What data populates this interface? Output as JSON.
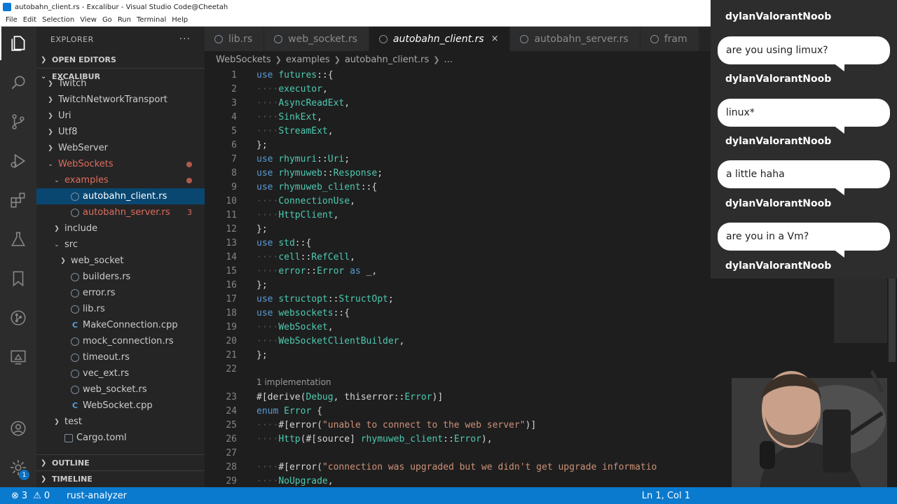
{
  "window": {
    "title": "autobahn_client.rs - Excalibur - Visual Studio Code@Cheetah"
  },
  "menu": [
    "File",
    "Edit",
    "Selection",
    "View",
    "Go",
    "Run",
    "Terminal",
    "Help"
  ],
  "sidebar": {
    "title": "EXPLORER",
    "more": "···",
    "open_editors": "OPEN EDITORS",
    "workspace": "EXCALIBUR",
    "items": [
      {
        "label": "Twitch",
        "type": "folder",
        "open": false
      },
      {
        "label": "TwitchNetworkTransport",
        "type": "folder",
        "open": false
      },
      {
        "label": "Uri",
        "type": "folder",
        "open": false
      },
      {
        "label": "Utf8",
        "type": "folder",
        "open": false
      },
      {
        "label": "WebServer",
        "type": "folder",
        "open": false
      },
      {
        "label": "WebSockets",
        "type": "folder",
        "open": true
      },
      {
        "label": "examples",
        "type": "folder",
        "open": true
      },
      {
        "label": "autobahn_client.rs",
        "type": "rs"
      },
      {
        "label": "autobahn_server.rs",
        "type": "rs",
        "problems": "3"
      },
      {
        "label": "include",
        "type": "folder",
        "open": false
      },
      {
        "label": "src",
        "type": "folder",
        "open": true
      },
      {
        "label": "web_socket",
        "type": "folder",
        "open": false
      },
      {
        "label": "builders.rs",
        "type": "rs"
      },
      {
        "label": "error.rs",
        "type": "rs"
      },
      {
        "label": "lib.rs",
        "type": "rs"
      },
      {
        "label": "MakeConnection.cpp",
        "type": "cpp"
      },
      {
        "label": "mock_connection.rs",
        "type": "rs"
      },
      {
        "label": "timeout.rs",
        "type": "rs"
      },
      {
        "label": "vec_ext.rs",
        "type": "rs"
      },
      {
        "label": "web_socket.rs",
        "type": "rs"
      },
      {
        "label": "WebSocket.cpp",
        "type": "cpp"
      },
      {
        "label": "test",
        "type": "folder",
        "open": false
      },
      {
        "label": "Cargo.toml",
        "type": "toml"
      }
    ],
    "outline": "OUTLINE",
    "timeline": "TIMELINE"
  },
  "tabs": [
    {
      "label": "lib.rs"
    },
    {
      "label": "web_socket.rs"
    },
    {
      "label": "autobahn_client.rs",
      "active": true,
      "close": "×"
    },
    {
      "label": "autobahn_server.rs"
    },
    {
      "label": "fram"
    }
  ],
  "breadcrumb": [
    "WebSockets",
    "examples",
    "autobahn_client.rs",
    "..."
  ],
  "editor": {
    "lens": "1 implementation",
    "lines": [
      {
        "n": "1",
        "tokens": [
          [
            "kw",
            "use"
          ],
          [
            "tx",
            " "
          ],
          [
            "ns",
            "futures"
          ],
          [
            "pn",
            "::{"
          ]
        ]
      },
      {
        "n": "2",
        "indent": 1,
        "tokens": [
          [
            "ty",
            "executor"
          ],
          [
            "pn",
            ","
          ]
        ]
      },
      {
        "n": "3",
        "indent": 1,
        "tokens": [
          [
            "ty",
            "AsyncReadExt"
          ],
          [
            "pn",
            ","
          ]
        ]
      },
      {
        "n": "4",
        "indent": 1,
        "tokens": [
          [
            "ty",
            "SinkExt"
          ],
          [
            "pn",
            ","
          ]
        ]
      },
      {
        "n": "5",
        "indent": 1,
        "tokens": [
          [
            "ty",
            "StreamExt"
          ],
          [
            "pn",
            ","
          ]
        ]
      },
      {
        "n": "6",
        "tokens": [
          [
            "pn",
            "};"
          ]
        ]
      },
      {
        "n": "7",
        "tokens": [
          [
            "kw",
            "use"
          ],
          [
            "tx",
            " "
          ],
          [
            "ns",
            "rhymuri"
          ],
          [
            "pn",
            "::"
          ],
          [
            "ty",
            "Uri"
          ],
          [
            "pn",
            ";"
          ]
        ]
      },
      {
        "n": "8",
        "tokens": [
          [
            "kw",
            "use"
          ],
          [
            "tx",
            " "
          ],
          [
            "ns",
            "rhymuweb"
          ],
          [
            "pn",
            "::"
          ],
          [
            "ty",
            "Response"
          ],
          [
            "pn",
            ";"
          ]
        ]
      },
      {
        "n": "9",
        "tokens": [
          [
            "kw",
            "use"
          ],
          [
            "tx",
            " "
          ],
          [
            "ns",
            "rhymuweb_client"
          ],
          [
            "pn",
            "::{"
          ]
        ]
      },
      {
        "n": "10",
        "indent": 1,
        "tokens": [
          [
            "ty",
            "ConnectionUse"
          ],
          [
            "pn",
            ","
          ]
        ]
      },
      {
        "n": "11",
        "indent": 1,
        "tokens": [
          [
            "ty",
            "HttpClient"
          ],
          [
            "pn",
            ","
          ]
        ]
      },
      {
        "n": "12",
        "tokens": [
          [
            "pn",
            "};"
          ]
        ]
      },
      {
        "n": "13",
        "tokens": [
          [
            "kw",
            "use"
          ],
          [
            "tx",
            " "
          ],
          [
            "ns",
            "std"
          ],
          [
            "pn",
            "::{"
          ]
        ]
      },
      {
        "n": "14",
        "indent": 1,
        "tokens": [
          [
            "ns",
            "cell"
          ],
          [
            "pn",
            "::"
          ],
          [
            "ty",
            "RefCell"
          ],
          [
            "pn",
            ","
          ]
        ]
      },
      {
        "n": "15",
        "indent": 1,
        "tokens": [
          [
            "ns",
            "error"
          ],
          [
            "pn",
            "::"
          ],
          [
            "ty",
            "Error"
          ],
          [
            "tx",
            " "
          ],
          [
            "kw",
            "as"
          ],
          [
            "tx",
            " "
          ],
          [
            "pn",
            "_,"
          ]
        ]
      },
      {
        "n": "16",
        "tokens": [
          [
            "pn",
            "};"
          ]
        ]
      },
      {
        "n": "17",
        "tokens": [
          [
            "kw",
            "use"
          ],
          [
            "tx",
            " "
          ],
          [
            "ns",
            "structopt"
          ],
          [
            "pn",
            "::"
          ],
          [
            "ty",
            "StructOpt"
          ],
          [
            "pn",
            ";"
          ]
        ]
      },
      {
        "n": "18",
        "tokens": [
          [
            "kw",
            "use"
          ],
          [
            "tx",
            " "
          ],
          [
            "ns",
            "websockets"
          ],
          [
            "pn",
            "::{"
          ]
        ]
      },
      {
        "n": "19",
        "indent": 1,
        "tokens": [
          [
            "ty",
            "WebSocket"
          ],
          [
            "pn",
            ","
          ]
        ]
      },
      {
        "n": "20",
        "indent": 1,
        "tokens": [
          [
            "ty",
            "WebSocketClientBuilder"
          ],
          [
            "pn",
            ","
          ]
        ]
      },
      {
        "n": "21",
        "tokens": [
          [
            "pn",
            "};"
          ]
        ]
      },
      {
        "n": "22",
        "tokens": []
      },
      {
        "n": "23",
        "lens": true,
        "tokens": [
          [
            "at",
            "#[derive("
          ],
          [
            "ty",
            "Debug"
          ],
          [
            "pn",
            ", "
          ],
          [
            "at",
            "thiserror"
          ],
          [
            "pn",
            "::"
          ],
          [
            "ty",
            "Error"
          ],
          [
            "at",
            ")]"
          ]
        ]
      },
      {
        "n": "24",
        "tokens": [
          [
            "kw",
            "enum"
          ],
          [
            "tx",
            " "
          ],
          [
            "ty",
            "Error"
          ],
          [
            "tx",
            " "
          ],
          [
            "pn",
            "{"
          ]
        ]
      },
      {
        "n": "25",
        "indent": 1,
        "tokens": [
          [
            "at",
            "#[error("
          ],
          [
            "st",
            "\"unable to connect to the web server\""
          ],
          [
            "at",
            ")]"
          ]
        ]
      },
      {
        "n": "26",
        "indent": 1,
        "tokens": [
          [
            "ty",
            "Http"
          ],
          [
            "pn",
            "(#[source] "
          ],
          [
            "ns",
            "rhymuweb_client"
          ],
          [
            "pn",
            "::"
          ],
          [
            "ty",
            "Error"
          ],
          [
            "pn",
            "),"
          ]
        ]
      },
      {
        "n": "27",
        "tokens": []
      },
      {
        "n": "28",
        "indent": 1,
        "tokens": [
          [
            "at",
            "#[error("
          ],
          [
            "st",
            "\"connection was upgraded but we didn't get upgrade informatio"
          ]
        ]
      },
      {
        "n": "29",
        "indent": 1,
        "tokens": [
          [
            "ty",
            "NoUpgrade"
          ],
          [
            "pn",
            ","
          ]
        ]
      }
    ]
  },
  "chat": {
    "top_user": "dylanValorantNoob",
    "messages": [
      {
        "text": "are you using limux?",
        "user": "dylanValorantNoob"
      },
      {
        "text": "linux*",
        "user": "dylanValorantNoob"
      },
      {
        "text": "a little haha",
        "user": "dylanValorantNoob"
      },
      {
        "text": "are you in a Vm?",
        "user": "dylanValorantNoob"
      }
    ]
  },
  "status": {
    "errors": "3",
    "warnings": "0",
    "server": "rust-analyzer",
    "position": "Ln 1, Col 1"
  },
  "activity_badge": "1",
  "colors": {
    "accent": "#0a7ace",
    "selection": "#094771",
    "error": "#e06c5a"
  }
}
